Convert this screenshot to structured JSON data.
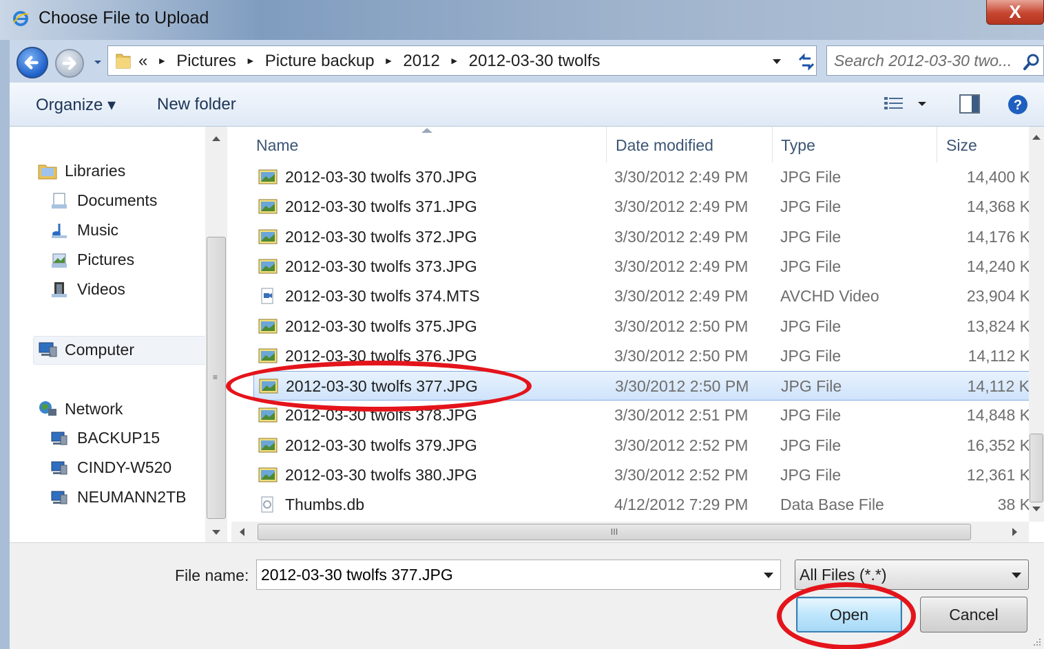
{
  "window": {
    "title": "Choose File to Upload",
    "close_glyph": "X"
  },
  "address": {
    "crumb_overflow": "«",
    "crumbs": [
      "Pictures",
      "Picture backup",
      "2012",
      "2012-03-30 twolfs"
    ],
    "search_placeholder": "Search 2012-03-30 two..."
  },
  "toolbar": {
    "organize_label": "Organize ▾",
    "new_folder_label": "New folder"
  },
  "nav": {
    "libraries": "Libraries",
    "documents": "Documents",
    "music": "Music",
    "pictures": "Pictures",
    "videos": "Videos",
    "computer": "Computer",
    "network": "Network",
    "hosts": [
      "BACKUP15",
      "CINDY-W520",
      "NEUMANN2TB"
    ]
  },
  "columns": {
    "name": "Name",
    "date": "Date modified",
    "type": "Type",
    "size": "Size"
  },
  "files": [
    {
      "name": "2012-03-30 twolfs 370.JPG",
      "date": "3/30/2012 2:49 PM",
      "type": "JPG File",
      "size": "14,400 K",
      "icon": "jpg"
    },
    {
      "name": "2012-03-30 twolfs 371.JPG",
      "date": "3/30/2012 2:49 PM",
      "type": "JPG File",
      "size": "14,368 K",
      "icon": "jpg"
    },
    {
      "name": "2012-03-30 twolfs 372.JPG",
      "date": "3/30/2012 2:49 PM",
      "type": "JPG File",
      "size": "14,176 K",
      "icon": "jpg"
    },
    {
      "name": "2012-03-30 twolfs 373.JPG",
      "date": "3/30/2012 2:49 PM",
      "type": "JPG File",
      "size": "14,240 K",
      "icon": "jpg"
    },
    {
      "name": "2012-03-30 twolfs 374.MTS",
      "date": "3/30/2012 2:49 PM",
      "type": "AVCHD Video",
      "size": "23,904 K",
      "icon": "video"
    },
    {
      "name": "2012-03-30 twolfs 375.JPG",
      "date": "3/30/2012 2:50 PM",
      "type": "JPG File",
      "size": "13,824 K",
      "icon": "jpg"
    },
    {
      "name": "2012-03-30 twolfs 376.JPG",
      "date": "3/30/2012 2:50 PM",
      "type": "JPG File",
      "size": "14,112 K",
      "icon": "jpg"
    },
    {
      "name": "2012-03-30 twolfs 377.JPG",
      "date": "3/30/2012 2:50 PM",
      "type": "JPG File",
      "size": "14,112 K",
      "icon": "jpg",
      "selected": true
    },
    {
      "name": "2012-03-30 twolfs 378.JPG",
      "date": "3/30/2012 2:51 PM",
      "type": "JPG File",
      "size": "14,848 K",
      "icon": "jpg"
    },
    {
      "name": "2012-03-30 twolfs 379.JPG",
      "date": "3/30/2012 2:52 PM",
      "type": "JPG File",
      "size": "16,352 K",
      "icon": "jpg"
    },
    {
      "name": "2012-03-30 twolfs 380.JPG",
      "date": "3/30/2012 2:52 PM",
      "type": "JPG File",
      "size": "12,361 K",
      "icon": "jpg"
    },
    {
      "name": "Thumbs.db",
      "date": "4/12/2012 7:29 PM",
      "type": "Data Base File",
      "size": "38 K",
      "icon": "db"
    }
  ],
  "scroll": {
    "grip": "≡",
    "hgrip": "III"
  },
  "footer": {
    "file_name_label": "File name:",
    "file_name_value": "2012-03-30 twolfs 377.JPG",
    "filter_value": "All Files (*.*)",
    "open_label": "Open",
    "cancel_label": "Cancel"
  },
  "colors": {
    "annotation": "#e4141b",
    "selection": "#cfe3fb"
  }
}
